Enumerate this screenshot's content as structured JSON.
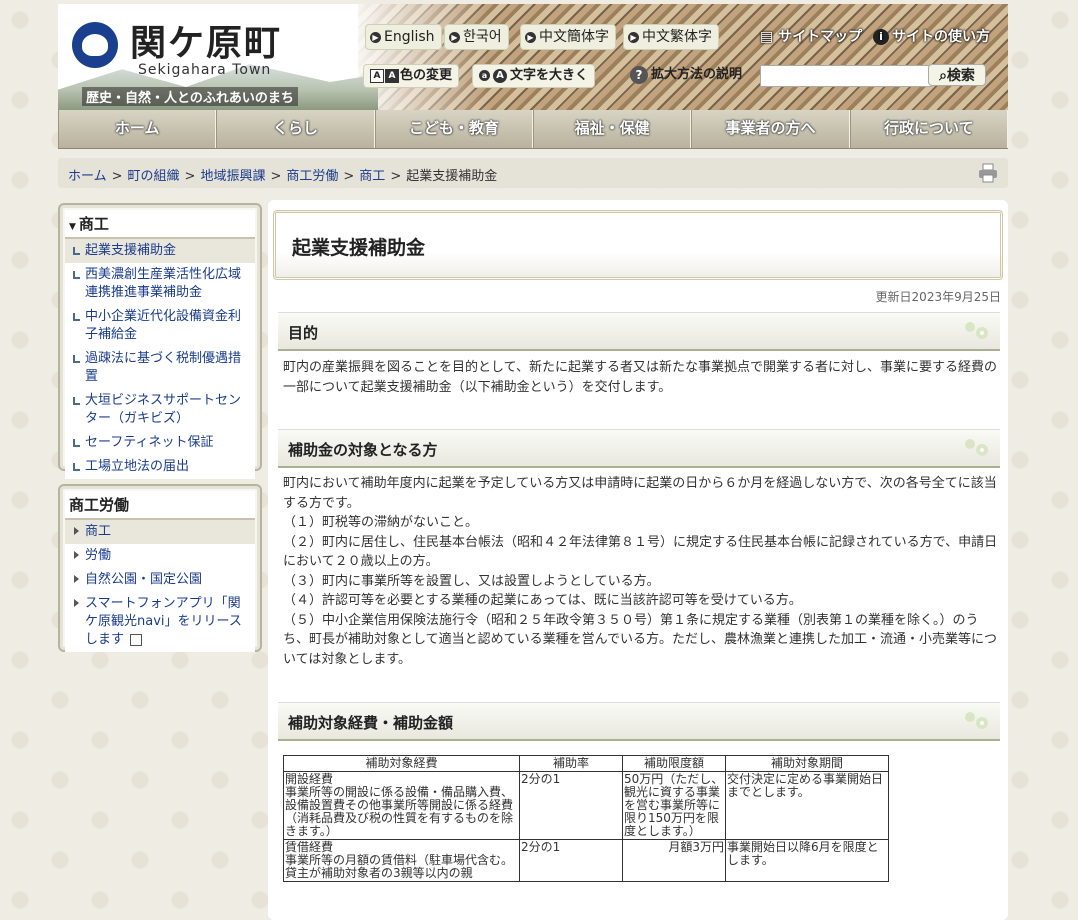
{
  "header": {
    "site_name": "関ケ原町",
    "site_name_en": "Sekigahara Town",
    "catchphrase": "歴史・自然・人とのふれあいのまち",
    "languages": [
      "English",
      "한국어",
      "中文簡体字",
      "中文繁体字"
    ],
    "sitemap": "サイトマップ",
    "site_usage": "サイトの使い方",
    "color_change": "色の変更",
    "text_size": "文字を大きく",
    "zoom_help": "拡大方法の説明",
    "search_placeholder": "",
    "search_button": "検索"
  },
  "gnav": [
    "ホーム",
    "くらし",
    "こども・教育",
    "福祉・保健",
    "事業者の方へ",
    "行政について"
  ],
  "breadcrumb": {
    "items": [
      "ホーム",
      "町の組織",
      "地域振興課",
      "商工労働",
      "商工"
    ],
    "sep": ">",
    "current": "起業支援補助金"
  },
  "sidebar": {
    "box1": {
      "title": "商工",
      "items": [
        "起業支援補助金",
        "西美濃創生産業活性化広域連携推進事業補助金",
        "中小企業近代化設備資金利子補給金",
        "過疎法に基づく税制優遇措置",
        "大垣ビジネスサポートセンター（ガキビズ）",
        "セーフティネット保証",
        "工場立地法の届出"
      ]
    },
    "box2": {
      "title": "商工労働",
      "items": [
        "商工",
        "労働",
        "自然公園・国定公園",
        "スマートフォンアプリ「関ケ原観光navi」をリリースします"
      ]
    }
  },
  "main": {
    "title": "起業支援補助金",
    "updated": "更新日2023年9月25日",
    "section1": {
      "heading": "目的",
      "text": "町内の産業振興を図ることを目的として、新たに起業する者又は新たな事業拠点で開業する者に対し、事業に要する経費の一部について起業支援補助金（以下補助金という）を交付します。"
    },
    "section2": {
      "heading": "補助金の対象となる方",
      "intro": "町内において補助年度内に起業を予定している方又は申請時に起業の日から６か月を経過しない方で、次の各号全てに該当する方です。",
      "items": [
        "（１）町税等の滞納がないこと。",
        "（２）町内に居住し、住民基本台帳法（昭和４２年法律第８１号）に規定する住民基本台帳に記録されている方で、申請日において２０歳以上の方。",
        "（３）町内に事業所等を設置し、又は設置しようとしている方。",
        "（４）許認可等を必要とする業種の起業にあっては、既に当該許認可等を受けている方。",
        "（５）中小企業信用保険法施行令（昭和２５年政令第３５０号）第１条に規定する業種（別表第１の業種を除く。）のうち、町長が補助対象として適当と認めている業種を営んでいる方。ただし、農林漁業と連携した加工・流通・小売業等については対象とします。"
      ]
    },
    "section3": {
      "heading": "補助対象経費・補助金額",
      "table": {
        "headers": [
          "補助対象経費",
          "補助率",
          "補助限度額",
          "補助対象期間"
        ],
        "rows": [
          {
            "name": "開設経費",
            "desc": "事業所等の開設に係る設備・備品購入費、設備設置費その他事業所等開設に係る経費（消耗品費及び税の性質を有するものを除きます。）",
            "rate": "2分の1",
            "limit": "50万円（ただし、観光に資する事業を営む事業所等に限り150万円を限度とします。）",
            "period": "交付決定に定める事業開始日までとします。"
          },
          {
            "name": "賃借経費",
            "desc": "事業所等の月額の賃借料（駐車場代含む。貸主が補助対象者の3親等以内の親",
            "rate": "2分の1",
            "limit": "月額3万円",
            "period": "事業開始日以降6月を限度とします。"
          }
        ]
      }
    }
  }
}
